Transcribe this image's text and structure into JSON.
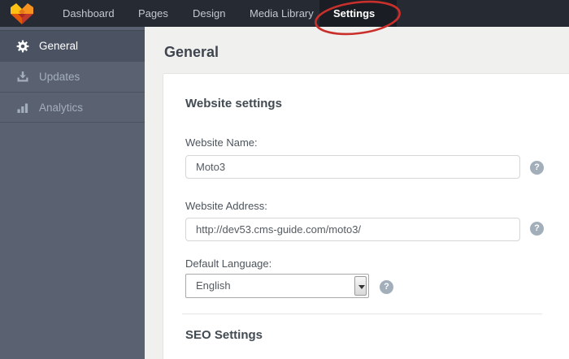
{
  "topbar": {
    "logo": "motocms-logo",
    "nav": [
      {
        "label": "Dashboard",
        "active": false
      },
      {
        "label": "Pages",
        "active": false
      },
      {
        "label": "Design",
        "active": false
      },
      {
        "label": "Media Library",
        "active": false
      },
      {
        "label": "Settings",
        "active": true
      }
    ]
  },
  "annotation": {
    "shape": "hand-drawn-ellipse",
    "target": "Settings",
    "color": "#c9302c"
  },
  "sidebar": {
    "items": [
      {
        "label": "General",
        "icon": "gear-icon",
        "active": true
      },
      {
        "label": "Updates",
        "icon": "download-icon",
        "active": false
      },
      {
        "label": "Analytics",
        "icon": "bar-chart-icon",
        "active": false
      }
    ]
  },
  "main": {
    "page_title": "General",
    "form": {
      "heading": "Website settings",
      "fields": [
        {
          "label": "Website Name:",
          "value": "Moto3",
          "type": "text",
          "help": true
        },
        {
          "label": "Website Address:",
          "value": "http://dev53.cms-guide.com/moto3/",
          "type": "text",
          "help": true
        },
        {
          "label": "Default Language:",
          "value": "English",
          "type": "select",
          "help": true
        }
      ]
    },
    "seo": {
      "heading": "SEO Settings"
    }
  },
  "icons": {
    "help_glyph": "?"
  },
  "colors": {
    "topbar_bg": "#262a32",
    "topbar_active_bg": "#1a1e24",
    "sidebar_bg": "#5a6272",
    "sidebar_active_bg": "#4b5363",
    "main_bg": "#f0f0ee",
    "panel_bg": "#ffffff",
    "annotation_red": "#c9302c",
    "help_icon_bg": "#a2aeb9"
  }
}
